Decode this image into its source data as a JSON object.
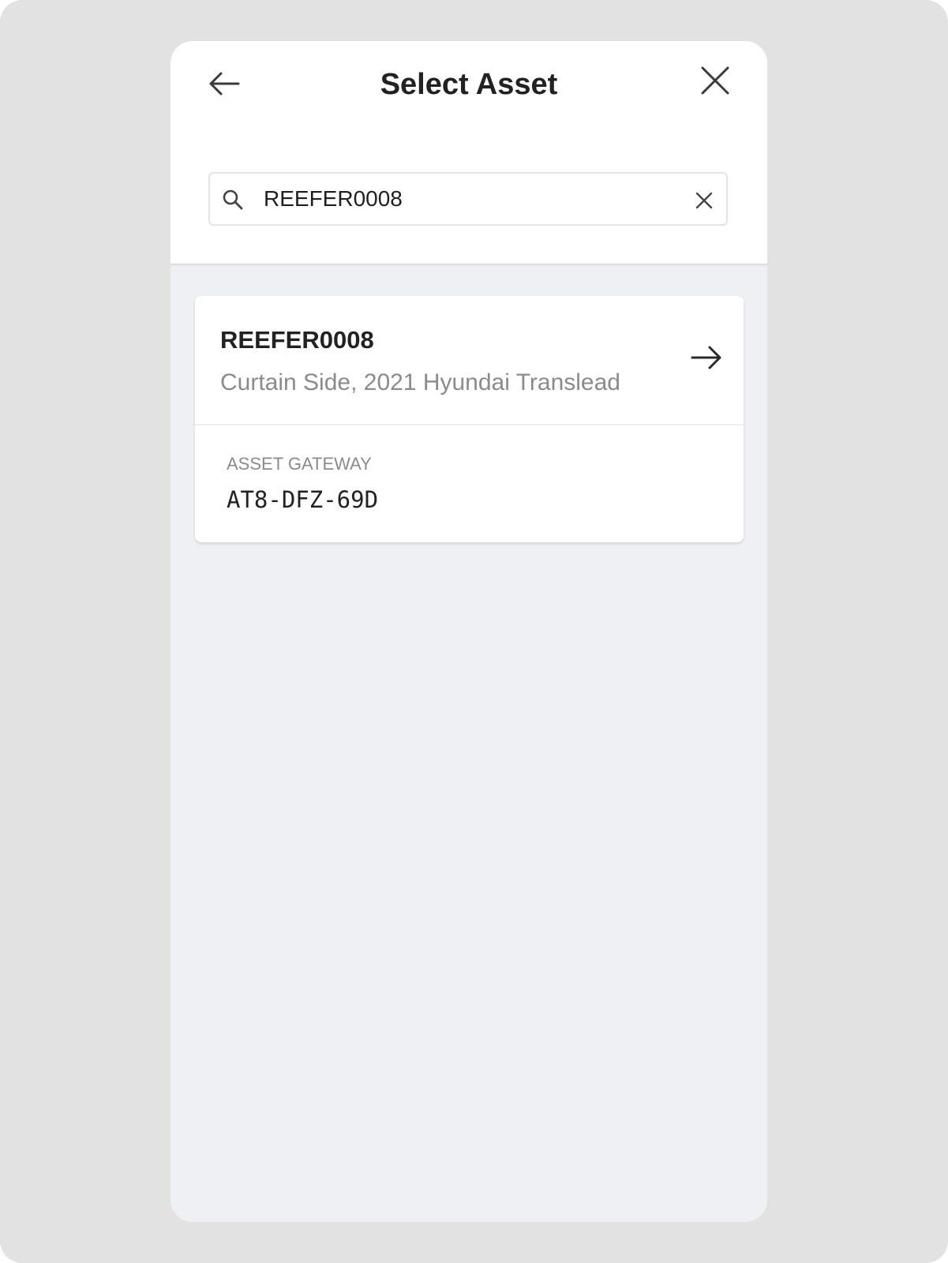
{
  "header": {
    "title": "Select Asset",
    "back_icon": "arrow-left-icon",
    "close_icon": "close-icon"
  },
  "search": {
    "value": "REEFER0008",
    "icon": "search-icon",
    "clear_icon": "clear-icon"
  },
  "results": [
    {
      "name": "REEFER0008",
      "description": "Curtain Side, 2021 Hyundai Translead",
      "open_icon": "arrow-right-icon",
      "gateway_label": "ASSET GATEWAY",
      "gateway_value": "AT8-DFZ-69D"
    }
  ],
  "colors": {
    "outer_background": "#e2e2e2",
    "panel_background": "#eff0f3",
    "surface": "#ffffff",
    "text_primary": "#222222",
    "text_secondary": "#8b8b8b"
  }
}
